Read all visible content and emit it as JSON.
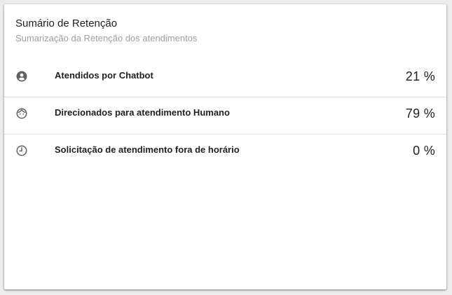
{
  "card": {
    "title": "Sumário de Retenção",
    "subtitle": "Sumarização da Retenção dos atendimentos"
  },
  "rows": [
    {
      "icon": "account-circle-icon",
      "label": "Atendidos por Chatbot",
      "value": "21 %"
    },
    {
      "icon": "face-icon",
      "label": "Direcionados para atendimento Humano",
      "value": "79 %"
    },
    {
      "icon": "clock-icon",
      "label": "Solicitação de atendimento fora de horário",
      "value": "0 %"
    }
  ],
  "colors": {
    "icon": "#616161",
    "divider": "#e0e0e0",
    "text": "#212121",
    "subtitle": "#9e9e9e"
  }
}
